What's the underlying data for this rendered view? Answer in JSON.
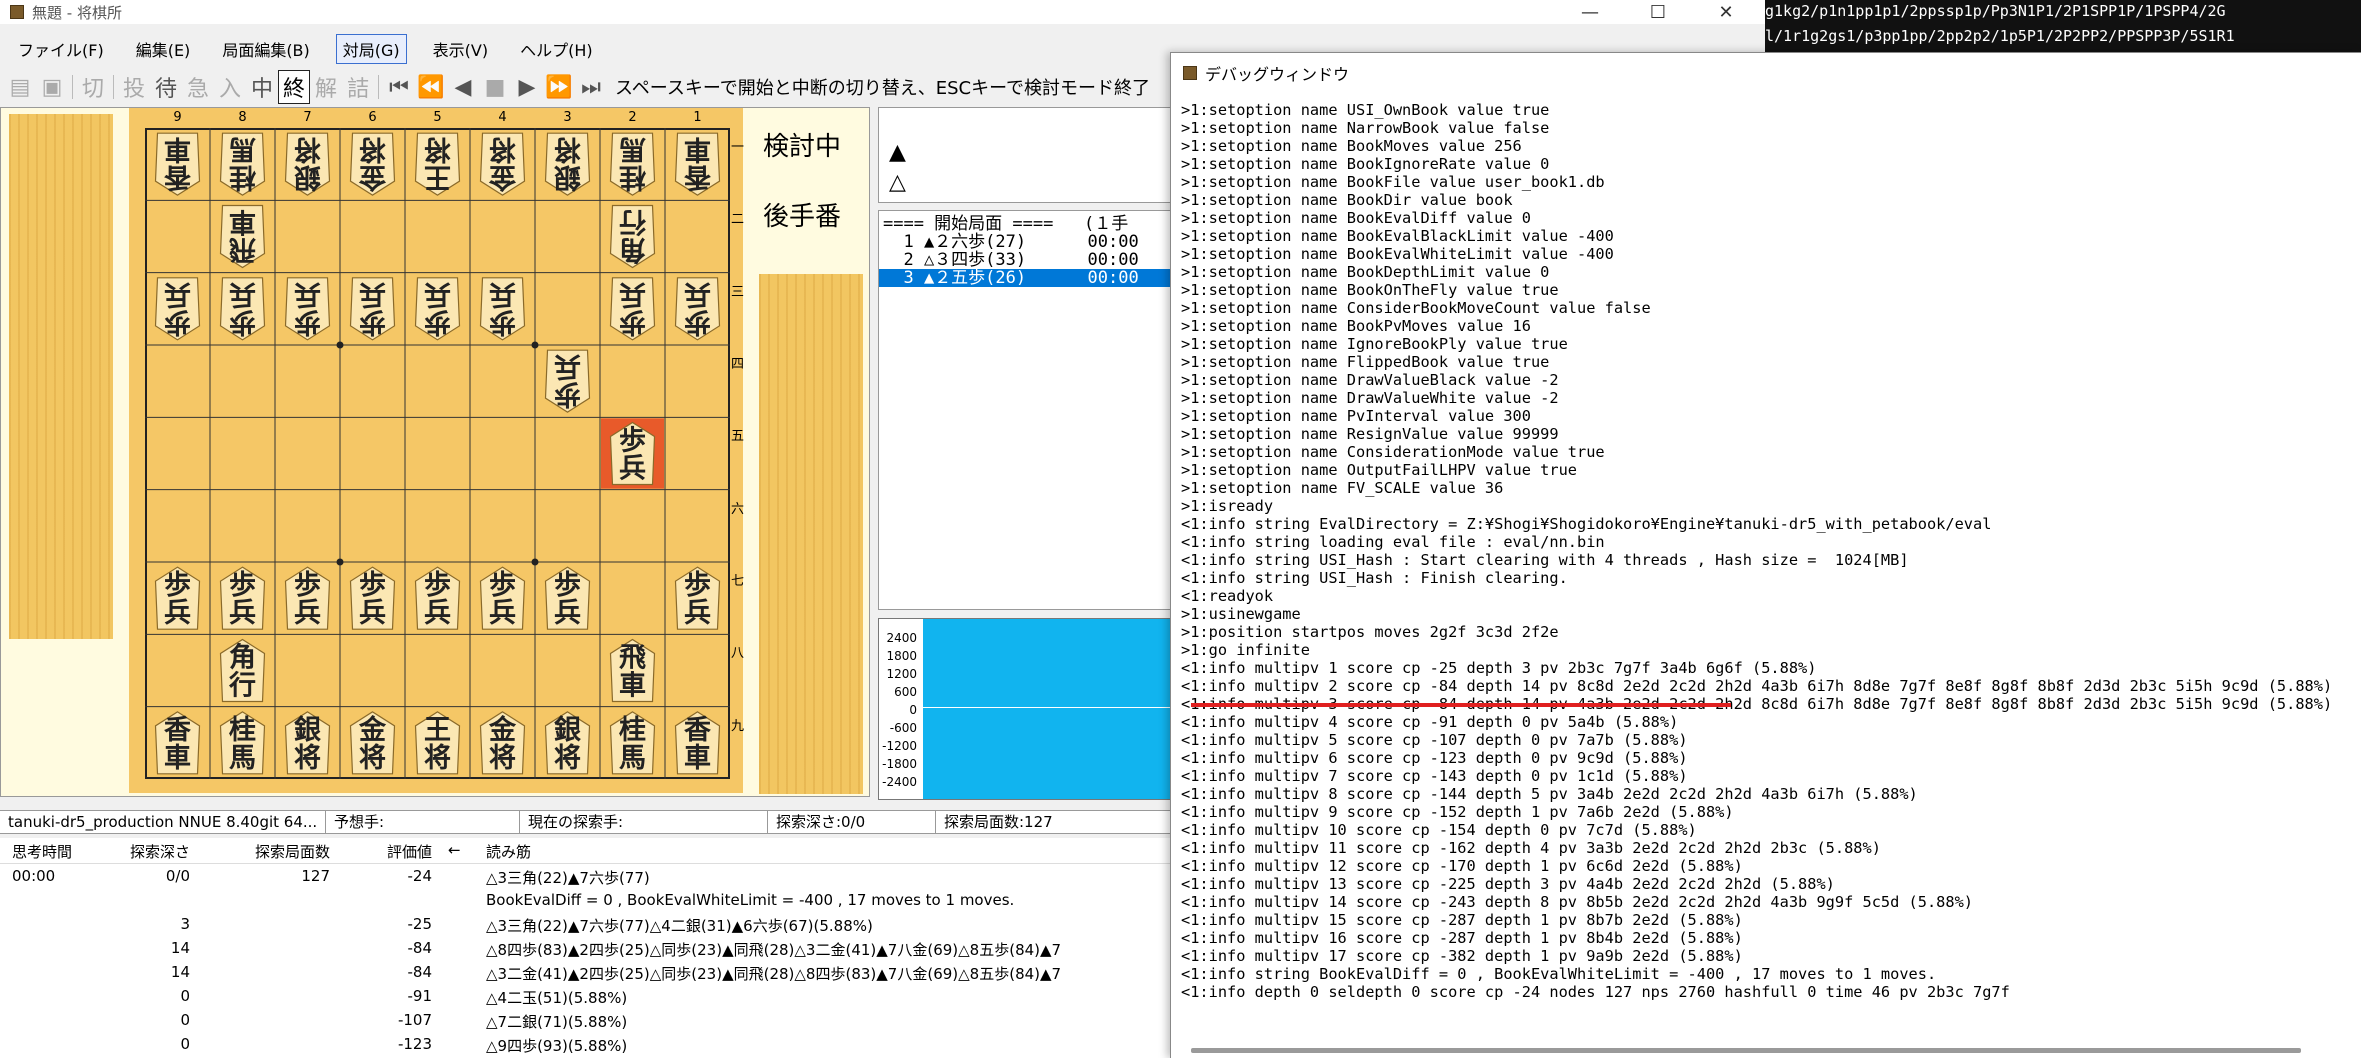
{
  "main_window": {
    "title": "無題 - 将棋所",
    "controls": [
      "—",
      "☐",
      "✕"
    ],
    "menu": [
      "ファイル(F)",
      "編集(E)",
      "局面編集(B)",
      "対局(G)",
      "表示(V)",
      "ヘルプ(H)"
    ],
    "menu_active_index": 3,
    "toolbar": {
      "labels": [
        "切",
        "投",
        "待",
        "急",
        "入",
        "中",
        "終",
        "解",
        "詰"
      ],
      "nav": [
        "⏮",
        "⏪",
        "◀",
        "■",
        "▶",
        "⏩",
        "⏭"
      ],
      "message": "スペースキーで開始と中断の切り替え、ESCキーで検討モード終了"
    }
  },
  "board": {
    "col_numbers": [
      "9",
      "8",
      "7",
      "6",
      "5",
      "4",
      "3",
      "2",
      "1"
    ],
    "row_numbers": [
      "一",
      "二",
      "三",
      "四",
      "五",
      "六",
      "七",
      "八",
      "九"
    ],
    "side_label_top": "検討中",
    "side_label_bottom": "後手番",
    "last_move_highlight": "#e85a2a",
    "pieces": [
      {
        "col": 9,
        "row": 1,
        "chars": "香車",
        "gote": true
      },
      {
        "col": 8,
        "row": 1,
        "chars": "桂馬",
        "gote": true
      },
      {
        "col": 7,
        "row": 1,
        "chars": "銀将",
        "gote": true
      },
      {
        "col": 6,
        "row": 1,
        "chars": "金将",
        "gote": true
      },
      {
        "col": 5,
        "row": 1,
        "chars": "王将",
        "gote": true
      },
      {
        "col": 4,
        "row": 1,
        "chars": "金将",
        "gote": true
      },
      {
        "col": 3,
        "row": 1,
        "chars": "銀将",
        "gote": true
      },
      {
        "col": 2,
        "row": 1,
        "chars": "桂馬",
        "gote": true
      },
      {
        "col": 1,
        "row": 1,
        "chars": "香車",
        "gote": true
      },
      {
        "col": 8,
        "row": 2,
        "chars": "飛車",
        "gote": true
      },
      {
        "col": 2,
        "row": 2,
        "chars": "角行",
        "gote": true
      },
      {
        "col": 9,
        "row": 3,
        "chars": "歩兵",
        "gote": true
      },
      {
        "col": 8,
        "row": 3,
        "chars": "歩兵",
        "gote": true
      },
      {
        "col": 7,
        "row": 3,
        "chars": "歩兵",
        "gote": true
      },
      {
        "col": 6,
        "row": 3,
        "chars": "歩兵",
        "gote": true
      },
      {
        "col": 5,
        "row": 3,
        "chars": "歩兵",
        "gote": true
      },
      {
        "col": 4,
        "row": 3,
        "chars": "歩兵",
        "gote": true
      },
      {
        "col": 2,
        "row": 3,
        "chars": "歩兵",
        "gote": true
      },
      {
        "col": 1,
        "row": 3,
        "chars": "歩兵",
        "gote": true
      },
      {
        "col": 3,
        "row": 4,
        "chars": "歩兵",
        "gote": true
      },
      {
        "col": 2,
        "row": 5,
        "chars": "歩兵",
        "gote": false,
        "highlight": true
      },
      {
        "col": 9,
        "row": 7,
        "chars": "歩兵",
        "gote": false
      },
      {
        "col": 8,
        "row": 7,
        "chars": "歩兵",
        "gote": false
      },
      {
        "col": 7,
        "row": 7,
        "chars": "歩兵",
        "gote": false
      },
      {
        "col": 6,
        "row": 7,
        "chars": "歩兵",
        "gote": false
      },
      {
        "col": 5,
        "row": 7,
        "chars": "歩兵",
        "gote": false
      },
      {
        "col": 4,
        "row": 7,
        "chars": "歩兵",
        "gote": false
      },
      {
        "col": 3,
        "row": 7,
        "chars": "歩兵",
        "gote": false
      },
      {
        "col": 1,
        "row": 7,
        "chars": "歩兵",
        "gote": false
      },
      {
        "col": 8,
        "row": 8,
        "chars": "角行",
        "gote": false
      },
      {
        "col": 2,
        "row": 8,
        "chars": "飛車",
        "gote": false
      },
      {
        "col": 9,
        "row": 9,
        "chars": "香車",
        "gote": false
      },
      {
        "col": 8,
        "row": 9,
        "chars": "桂馬",
        "gote": false
      },
      {
        "col": 7,
        "row": 9,
        "chars": "銀将",
        "gote": false
      },
      {
        "col": 6,
        "row": 9,
        "chars": "金将",
        "gote": false
      },
      {
        "col": 5,
        "row": 9,
        "chars": "王将",
        "gote": false
      },
      {
        "col": 4,
        "row": 9,
        "chars": "金将",
        "gote": false
      },
      {
        "col": 3,
        "row": 9,
        "chars": "銀将",
        "gote": false
      },
      {
        "col": 2,
        "row": 9,
        "chars": "桂馬",
        "gote": false
      },
      {
        "col": 1,
        "row": 9,
        "chars": "香車",
        "gote": false
      }
    ]
  },
  "players": {
    "sente_mark": "▲",
    "gote_mark": "△"
  },
  "kifu": [
    "==== 開始局面 ====   (１手",
    "  1 ▲２六歩(27)      00:00",
    "  2 △３四歩(33)      00:00",
    "  3 ▲２五歩(26)      00:00"
  ],
  "kifu_selected_index": 3,
  "graph": {
    "y_labels": [
      "2400",
      "1800",
      "1200",
      "600",
      "0",
      "-600",
      "-1200",
      "-1800",
      "-2400"
    ]
  },
  "status_bar": [
    "tanuki-dr5_production NNUE 8.40git 64...",
    "予想手:",
    "現在の探索手:",
    "探索深さ:0/0",
    "探索局面数:127"
  ],
  "engine_table": {
    "headers": [
      "思考時間",
      "探索深さ",
      "探索局面数",
      "評価値",
      "←",
      "読み筋"
    ],
    "rows": [
      [
        "00:00",
        "0/0",
        "127",
        "-24",
        "",
        "△3三角(22)▲7六歩(77)"
      ],
      [
        "",
        "",
        "",
        "",
        "",
        "BookEvalDiff = 0 , BookEvalWhiteLimit = -400 , 17 moves to 1 moves."
      ],
      [
        "",
        "3",
        "",
        "-25",
        "",
        "△3三角(22)▲7六歩(77)△4二銀(31)▲6六歩(67)(5.88%)"
      ],
      [
        "",
        "14",
        "",
        "-84",
        "",
        "△8四歩(83)▲2四歩(25)△同歩(23)▲同飛(28)△3二金(41)▲7八金(69)△8五歩(84)▲7"
      ],
      [
        "",
        "14",
        "",
        "-84",
        "",
        "△3二金(41)▲2四歩(25)△同歩(23)▲同飛(28)△8四歩(83)▲7八金(69)△8五歩(84)▲7"
      ],
      [
        "",
        "0",
        "",
        "-91",
        "",
        "△4二玉(51)(5.88%)"
      ],
      [
        "",
        "0",
        "",
        "-107",
        "",
        "△7二銀(71)(5.88%)"
      ],
      [
        "",
        "0",
        "",
        "-123",
        "",
        "△9四歩(93)(5.88%)"
      ]
    ]
  },
  "debug_window": {
    "title": "デバッグウィンドウ",
    "lines": [
      ">1:setoption name USI_OwnBook value true",
      ">1:setoption name NarrowBook value false",
      ">1:setoption name BookMoves value 256",
      ">1:setoption name BookIgnoreRate value 0",
      ">1:setoption name BookFile value user_book1.db",
      ">1:setoption name BookDir value book",
      ">1:setoption name BookEvalDiff value 0",
      ">1:setoption name BookEvalBlackLimit value -400",
      ">1:setoption name BookEvalWhiteLimit value -400",
      ">1:setoption name BookDepthLimit value 0",
      ">1:setoption name BookOnTheFly value true",
      ">1:setoption name ConsiderBookMoveCount value false",
      ">1:setoption name BookPvMoves value 16",
      ">1:setoption name IgnoreBookPly value true",
      ">1:setoption name FlippedBook value true",
      ">1:setoption name DrawValueBlack value -2",
      ">1:setoption name DrawValueWhite value -2",
      ">1:setoption name PvInterval value 300",
      ">1:setoption name ResignValue value 99999",
      ">1:setoption name ConsiderationMode value true",
      ">1:setoption name OutputFailLHPV value true",
      ">1:setoption name FV_SCALE value 36",
      ">1:isready",
      "<1:info string EvalDirectory = Z:¥Shogi¥Shogidokoro¥Engine¥tanuki-dr5_with_petabook/eval",
      "<1:info string loading eval file : eval/nn.bin",
      "<1:info string USI_Hash : Start clearing with 4 threads , Hash size =  1024[MB]",
      "<1:info string USI_Hash : Finish clearing.",
      "<1:readyok",
      ">1:usinewgame",
      ">1:position startpos moves 2g2f 3c3d 2f2e",
      ">1:go infinite",
      "<1:info multipv 1 score cp -25 depth 3 pv 2b3c 7g7f 3a4b 6g6f (5.88%)",
      "<1:info multipv 2 score cp -84 depth 14 pv 8c8d 2e2d 2c2d 2h2d 4a3b 6i7h 8d8e 7g7f 8e8f 8g8f 8b8f 2d3d 2b3c 5i5h 9c9d (5.88%)",
      "<1:info multipv 3 score cp -84 depth 14 pv 4a3b 2e2d 2c2d 2h2d 8c8d 6i7h 8d8e 7g7f 8e8f 8g8f 8b8f 2d3d 2b3c 5i5h 9c9d (5.88%)",
      "<1:info multipv 4 score cp -91 depth 0 pv 5a4b (5.88%)",
      "<1:info multipv 5 score cp -107 depth 0 pv 7a7b (5.88%)",
      "<1:info multipv 6 score cp -123 depth 0 pv 9c9d (5.88%)",
      "<1:info multipv 7 score cp -143 depth 0 pv 1c1d (5.88%)",
      "<1:info multipv 8 score cp -144 depth 5 pv 3a4b 2e2d 2c2d 2h2d 4a3b 6i7h (5.88%)",
      "<1:info multipv 9 score cp -152 depth 1 pv 7a6b 2e2d (5.88%)",
      "<1:info multipv 10 score cp -154 depth 0 pv 7c7d (5.88%)",
      "<1:info multipv 11 score cp -162 depth 4 pv 3a3b 2e2d 2c2d 2h2d 2b3c (5.88%)",
      "<1:info multipv 12 score cp -170 depth 1 pv 6c6d 2e2d (5.88%)",
      "<1:info multipv 13 score cp -225 depth 3 pv 4a4b 2e2d 2c2d 2h2d (5.88%)",
      "<1:info multipv 14 score cp -243 depth 8 pv 8b5b 2e2d 2c2d 2h2d 4a3b 9g9f 5c5d (5.88%)",
      "<1:info multipv 15 score cp -287 depth 1 pv 8b7b 2e2d (5.88%)",
      "<1:info multipv 16 score cp -287 depth 1 pv 8b4b 2e2d (5.88%)",
      "<1:info multipv 17 score cp -382 depth 1 pv 9a9b 2e2d (5.88%)",
      "<1:info string BookEvalDiff = 0 , BookEvalWhiteLimit = -400 , 17 moves to 1 moves.",
      "<1:info depth 0 seldepth 0 score cp -24 nodes 127 nps 2760 hashfull 0 time 46 pv 2b3c 7g7f"
    ],
    "underline_color": "#e02020"
  },
  "sfen_strip": [
    "g1kg2/p1n1pp1p1/2ppssp1p/Pp3N1P1/2P1SPP1P/1PSPP4/2G",
    "l/1r1g2gs1/p3pp1pp/2pp2p2/1p5P1/2P2PP2/PPSPP3P/5S1R1"
  ]
}
